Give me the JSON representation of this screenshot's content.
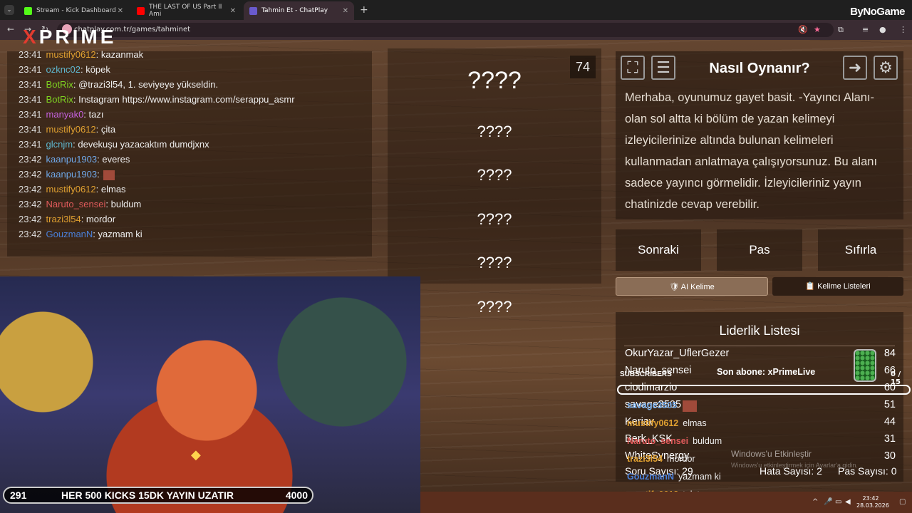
{
  "browser": {
    "tabs": [
      {
        "label": "Stream - Kick Dashboard",
        "color": "#53fc18"
      },
      {
        "label": "THE LAST OF US Part II Ami",
        "color": "#ff0000"
      },
      {
        "label": "Tahmin Et - ChatPlay",
        "color": "#6a5acd"
      }
    ],
    "url": "chatplay.com.tr/games/tahminet",
    "brand": "ByNoGame"
  },
  "overlay_logo": {
    "prefix": "X",
    "rest": "PRIME"
  },
  "chat": [
    {
      "time": "23:41",
      "user": "mustify0612",
      "color": "#e0a030",
      "msg": "kazanmak"
    },
    {
      "time": "23:41",
      "user": "ozknc02",
      "color": "#5fb8d0",
      "msg": "köpek"
    },
    {
      "time": "23:41",
      "user": "BotRix",
      "color": "#7ed321",
      "msg": "@trazi3l54, 1. seviyeye yükseldin."
    },
    {
      "time": "23:41",
      "user": "BotRix",
      "color": "#7ed321",
      "msg": "Instagram https://www.instagram.com/serappu_asmr"
    },
    {
      "time": "23:41",
      "user": "manyak0",
      "color": "#c561e0",
      "msg": "tazı"
    },
    {
      "time": "23:41",
      "user": "mustify0612",
      "color": "#e0a030",
      "msg": "çita"
    },
    {
      "time": "23:41",
      "user": "glcnjm",
      "color": "#5fb8d0",
      "msg": "devekuşu yazacaktım dumdjxnx"
    },
    {
      "time": "23:42",
      "user": "kaanpu1903",
      "color": "#6fa8e8",
      "msg": "everes"
    },
    {
      "time": "23:42",
      "user": "kaanpu1903",
      "color": "#6fa8e8",
      "msg": ""
    },
    {
      "time": "23:42",
      "user": "mustify0612",
      "color": "#e0a030",
      "msg": "elmas"
    },
    {
      "time": "23:42",
      "user": "Naruto_sensei",
      "color": "#e05a5a",
      "msg": "buldum"
    },
    {
      "time": "23:42",
      "user": "trazi3l54",
      "color": "#e0a030",
      "msg": "mordor"
    },
    {
      "time": "23:42",
      "user": "GouzmanN",
      "color": "#4a7fd8",
      "msg": "yazmam ki"
    }
  ],
  "game": {
    "counter": "74",
    "words": [
      "????",
      "????",
      "????",
      "????",
      "????",
      "????"
    ],
    "howto_title": "Nasıl Oynanır?",
    "howto_text": "Merhaba, oyunumuz gayet basit. -Yayıncı Alanı- olan sol altta ki bölüm de yazan kelimeyi izleyicilerinize altında bulunan kelimeleri kullanmadan anlatmaya çalışıyorsunuz. Bu alanı sadece yayıncı görmelidir. İzleyicileriniz yayın chatinizde cevap verebilir.",
    "buttons": {
      "next": "Sonraki",
      "pass": "Pas",
      "reset": "Sıfırla"
    },
    "ai_word": "🛡 AI Kelime",
    "word_lists": "📋 Kelime Listeleri",
    "leaderboard_title": "Liderlik Listesi",
    "leaderboard": [
      {
        "name": "OkurYazar_UflerGezer",
        "score": "84"
      },
      {
        "name": "Naruto_sensei",
        "score": "66"
      },
      {
        "name": "ciodimarzio",
        "score": "60"
      },
      {
        "name": "savage3505",
        "score": "51"
      },
      {
        "name": "Keriav",
        "score": "44"
      },
      {
        "name": "Berk_KSK",
        "score": "31"
      },
      {
        "name": "WhiteSynergy",
        "score": "30"
      }
    ],
    "question_count": "Soru Sayısı: 29",
    "error_count": "Hata Sayısı: 2",
    "pass_count": "Pas Sayısı: 0"
  },
  "stream_overlay": {
    "subs_label": "SUBSCRIBERS",
    "last_sub": "Son abone: xPrimeLive",
    "sub_count": "0 / 15",
    "chat": [
      {
        "user": "savage3505",
        "color": "#6fa8e8",
        "msg": ""
      },
      {
        "user": "mustify0612",
        "color": "#e0a030",
        "msg": "elmas"
      },
      {
        "user": "Naruto_sensei",
        "color": "#e05a5a",
        "msg": "buldum"
      },
      {
        "user": "trazi3l54",
        "color": "#e0a030",
        "msg": "mordor"
      },
      {
        "user": "GouzmanN",
        "color": "#4a7fd8",
        "msg": "yazmam ki"
      },
      {
        "user": "mustify0612",
        "color": "#e0a030",
        "msg": "tek taş"
      }
    ],
    "kick_left": "291",
    "kick_text": "HER 500 KICKS 15DK YAYIN UZATIR",
    "kick_right": "4000",
    "windows_activate": "Windows'u Etkinleştir",
    "windows_activate_sub": "Windows'u etkinleştirmek için Ayarlar'a gidin."
  },
  "taskbar": {
    "time": "23:42",
    "date": "28.03.2026"
  }
}
